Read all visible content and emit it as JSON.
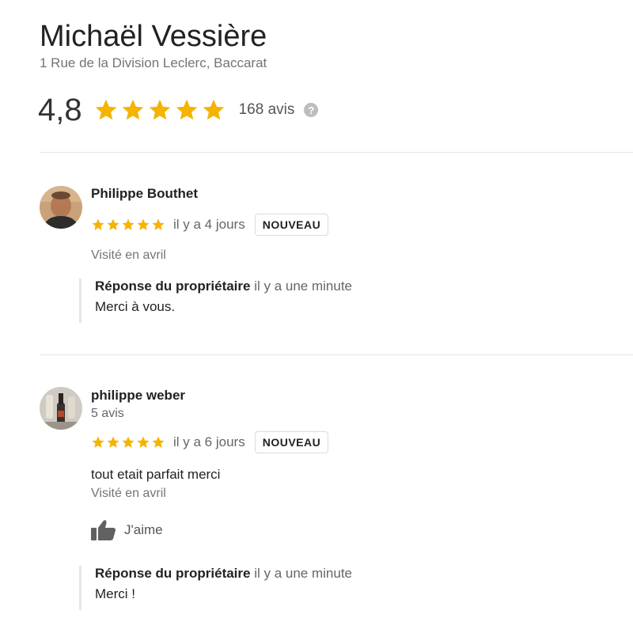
{
  "place": {
    "name": "Michaël Vessière",
    "address": "1 Rue de la Division Leclerc, Baccarat",
    "rating": "4,8",
    "stars": 5,
    "review_count": "168 avis",
    "help_icon": "?"
  },
  "colors": {
    "star": "#f4b400",
    "badge_border": "#dadce0",
    "reply_border": "#e6e6e6"
  },
  "reviews": [
    {
      "author": "Philippe Bouthet",
      "stars": 5,
      "time": "il y a 4 jours",
      "badge": "NOUVEAU",
      "visited": "Visité en avril",
      "reply": {
        "title": "Réponse du propriétaire",
        "time": "il y a une minute",
        "text": "Merci à vous."
      }
    },
    {
      "author": "philippe weber",
      "author_reviews": "5 avis",
      "stars": 5,
      "time": "il y a 6 jours",
      "badge": "NOUVEAU",
      "text": "tout etait parfait merci",
      "visited": "Visité en avril",
      "like_label": "J'aime",
      "reply": {
        "title": "Réponse du propriétaire",
        "time": "il y a une minute",
        "text": "Merci !"
      }
    }
  ]
}
